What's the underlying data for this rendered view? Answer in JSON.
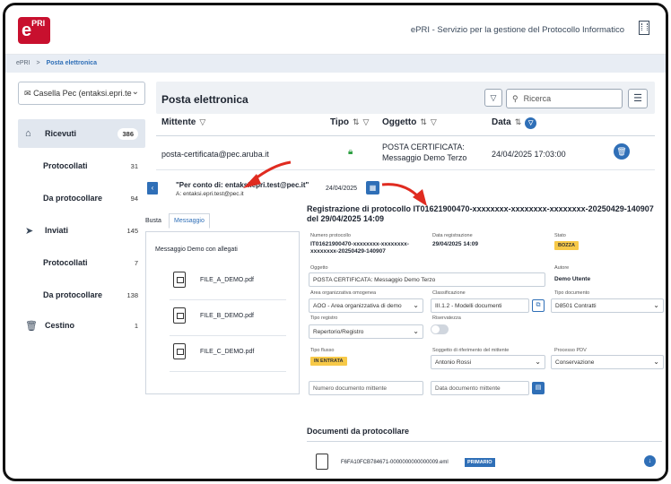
{
  "header": {
    "logo_text": "e",
    "logo_sup": "PRI",
    "app_title": "ePRI - Servizio per la gestione del Protocollo Informatico",
    "brand_color": "#c8102e",
    "accent_color": "#2f6fb7"
  },
  "breadcrumb": {
    "root": "ePRI",
    "separator": ">",
    "current": "Posta elettronica"
  },
  "sidebar": {
    "mailbox_select": "Casella Pec (entaksi.epri.te",
    "items": [
      {
        "label": "Ricevuti",
        "count": "386",
        "icon": "inbox-icon",
        "active": true
      },
      {
        "label": "Protocollati",
        "count": "31"
      },
      {
        "label": "Da protocollare",
        "count": "94"
      },
      {
        "label": "Inviati",
        "count": "145",
        "icon": "send-icon"
      },
      {
        "label": "Protocollati",
        "count": "7"
      },
      {
        "label": "Da protocollare",
        "count": "138"
      },
      {
        "label": "Cestino",
        "count": "1",
        "icon": "trash-icon"
      }
    ]
  },
  "main": {
    "title": "Posta elettronica",
    "search_placeholder": "Ricerca",
    "columns": {
      "mittente": "Mittente",
      "tipo": "Tipo",
      "oggetto": "Oggetto",
      "data": "Data"
    },
    "row": {
      "mittente": "posta-certificata@pec.aruba.it",
      "oggetto_line1": "POSTA CERTIFICATA:",
      "oggetto_line2": "Messaggio Demo Terzo",
      "data": "24/04/2025 17:03:00"
    }
  },
  "detail": {
    "per_conto": "\"Per conto di: entaksi.epri.test@pec.it\"",
    "to": "A: entaksi.epri.test@pec.it",
    "date": "24/04/2025",
    "tabs": {
      "busta": "Busta",
      "messaggio": "Messaggio"
    },
    "message_title": "Messaggio Demo con allegati",
    "attachments": [
      "FILE_A_DEMO.pdf",
      "FILE_B_DEMO.pdf",
      "FILE_C_DEMO.pdf"
    ]
  },
  "registration": {
    "title": "Registrazione di protocollo IT01621900470-xxxxxxxx-xxxxxxxx-xxxxxxxx-20250429-140907 del 29/04/2025 14:09",
    "numero_label": "Numero protocollo",
    "numero_value": "IT01621900470-xxxxxxxx-xxxxxxxx-xxxxxxxx-20250429-140907",
    "data_reg_label": "Data registrazione",
    "data_reg_value": "29/04/2025 14:09",
    "stato_label": "Stato",
    "stato_value": "BOZZA",
    "oggetto_label": "Oggetto",
    "oggetto_value": "POSTA CERTIFICATA: Messaggio Demo Terzo",
    "autore_label": "Autore",
    "autore_value": "Demo Utente",
    "aoo_label": "Area organizzativa omogenea",
    "aoo_value": "AOO - Area organizzativa di demo",
    "class_label": "Classificazione",
    "class_value": "III.1.2 - Modelli documenti",
    "tipodoc_label": "Tipo documento",
    "tipodoc_value": "D8501 Contratti",
    "tiporeg_label": "Tipo registro",
    "tiporeg_value": "Repertorio/Registro",
    "riserv_label": "Riservatezza",
    "flusso_label": "Tipo flusso",
    "flusso_value": "IN ENTRATA",
    "sogg_label": "Soggetto di riferimento del mittente",
    "sogg_value": "Antonio Rossi",
    "pdv_label": "Processo PDV",
    "pdv_value": "Conservazione",
    "num_doc_placeholder": "Numero documento mittente",
    "data_doc_placeholder": "Data documento mittente"
  },
  "documents": {
    "title": "Documenti da protocollare",
    "file": "F6FA10FCB784671-0000000000000009.eml",
    "badge": "PRIMARIO"
  }
}
